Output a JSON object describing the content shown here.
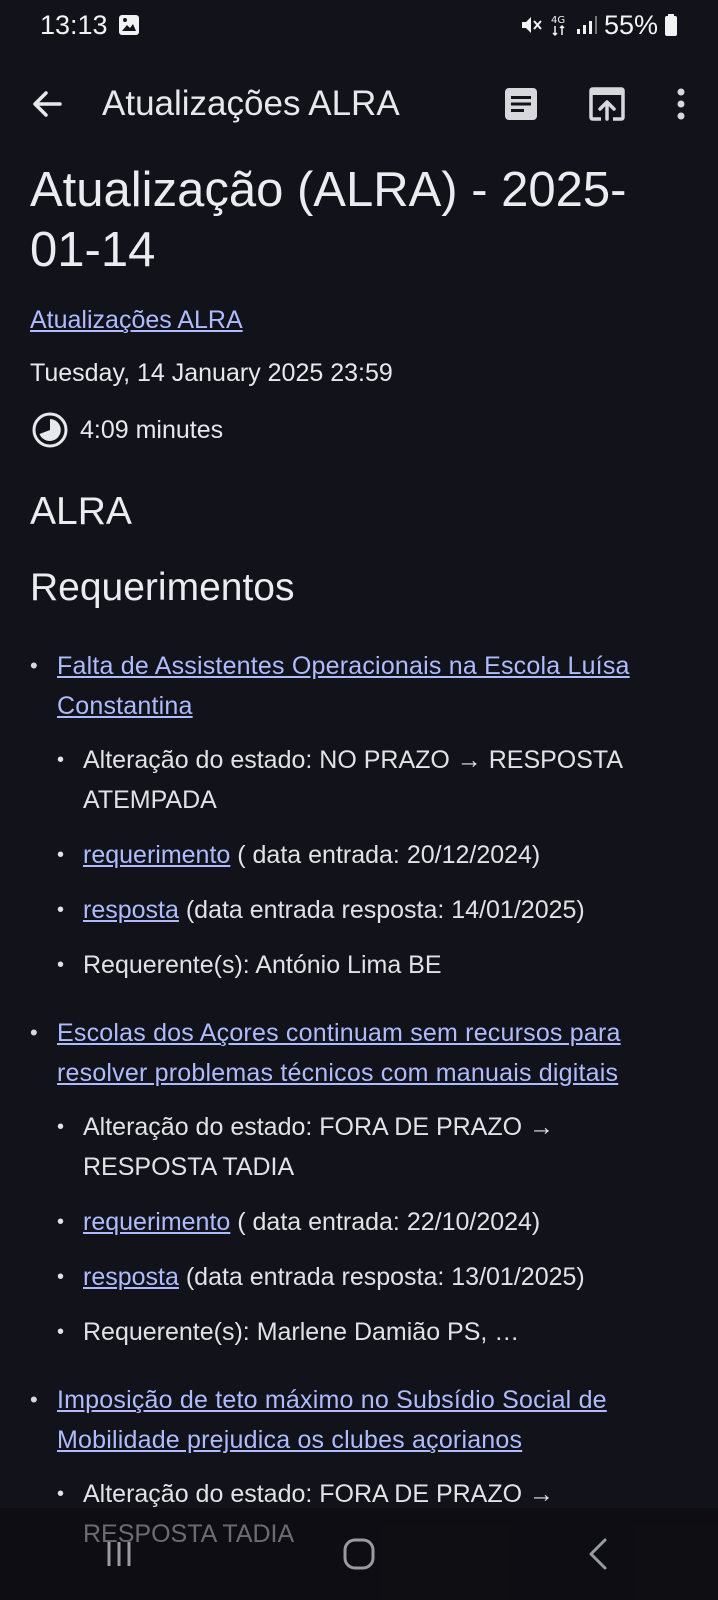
{
  "status": {
    "time": "13:13",
    "battery": "55%"
  },
  "appbar": {
    "title": "Atualizações ALRA"
  },
  "article": {
    "title": "Atualização (ALRA) - 2025-01-14",
    "feed": "Atualizações ALRA",
    "date": "Tuesday, 14 January 2025 23:59",
    "read_time": "4:09 minutes",
    "heading1": "ALRA",
    "heading2": "Requerimentos"
  },
  "items": [
    {
      "title": "Falta de Assistentes Operacionais na Escola Luísa Constantina",
      "status": "Alteração do estado: NO PRAZO → RESPOSTA ATEMPADA",
      "req_link": "requerimento",
      "req_text": " ( data entrada: 20/12/2024)",
      "resp_link": "resposta",
      "resp_text": " (data entrada resposta: 14/01/2025)",
      "requester": "Requerente(s): António Lima BE"
    },
    {
      "title": "Escolas dos Açores continuam sem recursos para resolver problemas técnicos com manuais digitais",
      "status": "Alteração do estado: FORA DE PRAZO → RESPOSTA TADIA",
      "req_link": "requerimento",
      "req_text": " ( data entrada: 22/10/2024)",
      "resp_link": "resposta",
      "resp_text": " (data entrada resposta: 13/01/2025)",
      "requester": "Requerente(s): Marlene Damião PS, …"
    },
    {
      "title": "Imposição de teto máximo no Subsídio Social de Mobilidade prejudica os clubes açorianos",
      "status": "Alteração do estado: FORA DE PRAZO → RESPOSTA TADIA"
    }
  ],
  "colors": {
    "background": "#12131a",
    "link": "#aebcff",
    "text": "#e6e6ea"
  },
  "icons": {
    "back": "arrow-left",
    "reader": "article",
    "open_in_browser": "open-in-browser",
    "more": "more-vertical",
    "read_time": "clock-half"
  }
}
